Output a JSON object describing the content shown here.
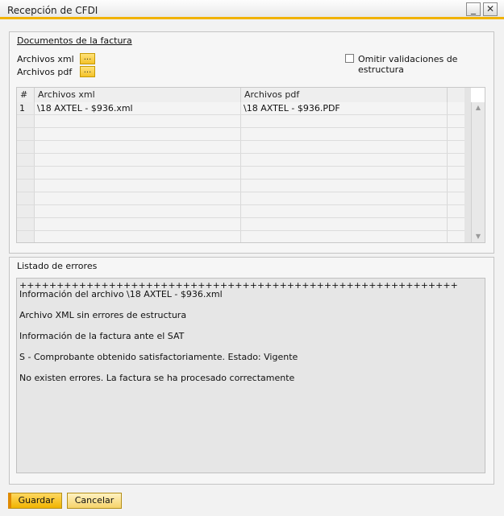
{
  "window": {
    "title": "Recepción de CFDI",
    "minimize_glyph": "_",
    "close_glyph": "✕"
  },
  "documents": {
    "section_title": "Documentos de la factura",
    "xml_label": "Archivos xml",
    "pdf_label": "Archivos pdf",
    "browse_label": "...",
    "omit_validation_label": "Omitir validaciones de estructura",
    "omit_validation_checked": false
  },
  "grid": {
    "columns": [
      "#",
      "Archivos xml",
      "Archivos pdf"
    ],
    "rows": [
      {
        "num": "1",
        "xml": "\\18 AXTEL - $936.xml",
        "pdf": "\\18 AXTEL - $936.PDF"
      },
      {
        "num": "",
        "xml": "",
        "pdf": ""
      },
      {
        "num": "",
        "xml": "",
        "pdf": ""
      },
      {
        "num": "",
        "xml": "",
        "pdf": ""
      },
      {
        "num": "",
        "xml": "",
        "pdf": ""
      },
      {
        "num": "",
        "xml": "",
        "pdf": ""
      },
      {
        "num": "",
        "xml": "",
        "pdf": ""
      },
      {
        "num": "",
        "xml": "",
        "pdf": ""
      },
      {
        "num": "",
        "xml": "",
        "pdf": ""
      },
      {
        "num": "",
        "xml": "",
        "pdf": ""
      },
      {
        "num": "",
        "xml": "",
        "pdf": ""
      }
    ]
  },
  "errors": {
    "section_title": "Listado de errores",
    "lines": [
      "+++++++++++++++++++++++++++++++++++++++++++++++++++++++++++",
      "Información del archivo \\18 AXTEL - $936.xml",
      "Archivo XML sin errores de estructura",
      "Información de la factura ante el SAT",
      "S - Comprobante obtenido satisfactoriamente. Estado: Vigente",
      "No existen errores. La factura se ha procesado correctamente"
    ]
  },
  "buttons": {
    "save": "Guardar",
    "cancel": "Cancelar"
  },
  "colors": {
    "accent": "#f1b200",
    "button_primary": "#f0b400"
  }
}
